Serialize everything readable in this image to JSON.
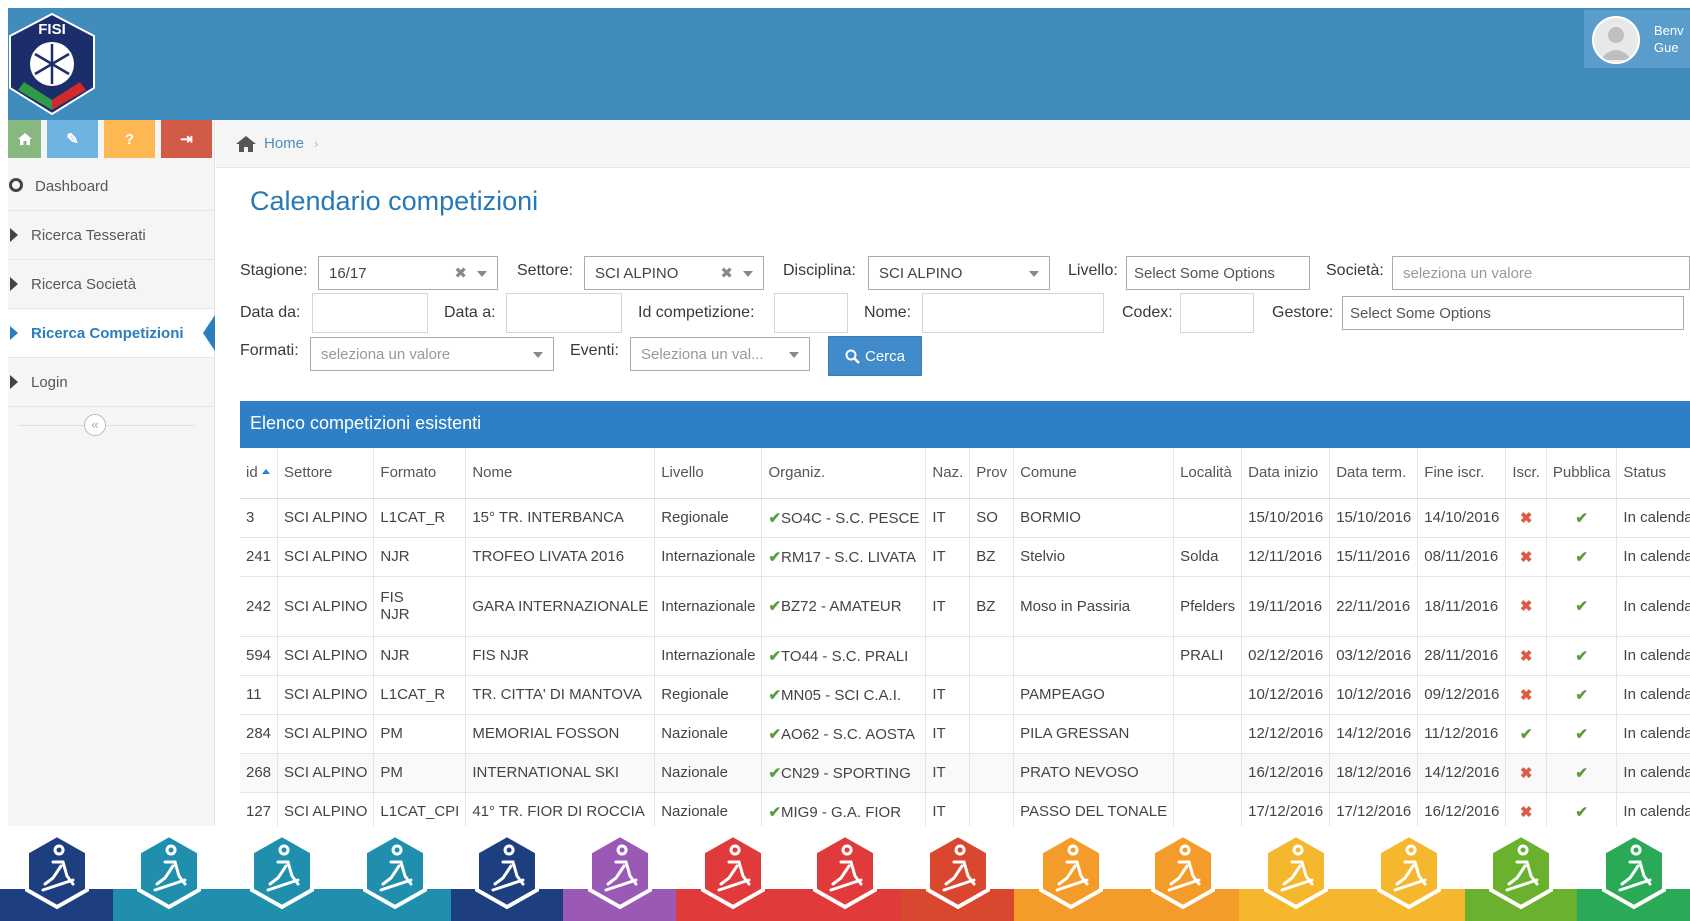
{
  "header": {
    "logo_text": "FISI",
    "user_line1": "Benv",
    "user_line2": "Gue"
  },
  "shortcuts": [
    {
      "icon": "home-icon",
      "color": "#87b87f"
    },
    {
      "icon": "pencil-icon",
      "color": "#6fb3e0",
      "label": "✎"
    },
    {
      "icon": "question-icon",
      "color": "#ffb752",
      "label": "?"
    },
    {
      "icon": "signout-icon",
      "color": "#d15b47",
      "label": "⇥"
    }
  ],
  "sidebar": {
    "items": [
      {
        "label": "Dashboard",
        "icon": "tachometer-icon",
        "active": false
      },
      {
        "label": "Ricerca Tesserati",
        "active": false
      },
      {
        "label": "Ricerca Società",
        "active": false
      },
      {
        "label": "Ricerca Competizioni",
        "active": true
      },
      {
        "label": "Login",
        "active": false
      }
    ],
    "collapse_label": "«"
  },
  "breadcrumb": {
    "home": "Home",
    "sep": "›"
  },
  "page_title": "Calendario competizioni",
  "filters": {
    "stagione_label": "Stagione:",
    "stagione_value": "16/17",
    "settore_label": "Settore:",
    "settore_value": "SCI ALPINO",
    "disciplina_label": "Disciplina:",
    "disciplina_value": "SCI ALPINO",
    "livello_label": "Livello:",
    "livello_value": "Select Some Options",
    "societa_label": "Società:",
    "societa_placeholder": "seleziona un valore",
    "data_da_label": "Data da:",
    "data_a_label": "Data a:",
    "id_label": "Id competizione:",
    "nome_label": "Nome:",
    "codex_label": "Codex:",
    "gestore_label": "Gestore:",
    "gestore_value": "Select Some Options",
    "formati_label": "Formati:",
    "formati_placeholder": "seleziona un valore",
    "eventi_label": "Eventi:",
    "eventi_placeholder": "Seleziona un val...",
    "cerca_label": "Cerca",
    "clear_glyph": "✖"
  },
  "table": {
    "title": "Elenco competizioni esistenti",
    "columns": [
      "id",
      "Settore",
      "Formato",
      "Nome",
      "Livello",
      "Organiz.",
      "Naz.",
      "Prov",
      "Comune",
      "Località",
      "Data inizio",
      "Data term.",
      "Fine iscr.",
      "Iscr.",
      "Pubblica",
      "Status"
    ],
    "rows": [
      {
        "id": "3",
        "settore": "SCI ALPINO",
        "formato": "L1CAT_R",
        "formato2": "",
        "nome": "15° TR. INTERBANCA",
        "livello": "Regionale",
        "organiz": "SO4C - S.C. PESCE",
        "naz": "IT",
        "prov": "SO",
        "comune": "BORMIO",
        "localita": "",
        "inizio": "15/10/2016",
        "term": "15/10/2016",
        "fine": "14/10/2016",
        "iscr": "no",
        "pubblica": "ok",
        "status": "In calendario"
      },
      {
        "id": "241",
        "settore": "SCI ALPINO",
        "formato": "NJR",
        "formato2": "",
        "nome": "TROFEO LIVATA 2016",
        "livello": "Internazionale",
        "organiz": "RM17 - S.C. LIVATA",
        "naz": "IT",
        "prov": "BZ",
        "comune": "Stelvio",
        "localita": "Solda",
        "inizio": "12/11/2016",
        "term": "15/11/2016",
        "fine": "08/11/2016",
        "iscr": "no",
        "pubblica": "ok",
        "status": "In calendario"
      },
      {
        "id": "242",
        "settore": "SCI ALPINO",
        "formato": "FIS",
        "formato2": "NJR",
        "nome": "GARA INTERNAZIONALE",
        "livello": "Internazionale",
        "organiz": "BZ72 - AMATEUR",
        "naz": "IT",
        "prov": "BZ",
        "comune": "Moso in Passiria",
        "localita": "Pfelders",
        "inizio": "19/11/2016",
        "term": "22/11/2016",
        "fine": "18/11/2016",
        "iscr": "no",
        "pubblica": "ok",
        "status": "In calendario"
      },
      {
        "id": "594",
        "settore": "SCI ALPINO",
        "formato": "NJR",
        "formato2": "",
        "nome": "FIS NJR",
        "livello": "Internazionale",
        "organiz": "TO44 - S.C. PRALI",
        "naz": "",
        "prov": "",
        "comune": "",
        "localita": "PRALI",
        "inizio": "02/12/2016",
        "term": "03/12/2016",
        "fine": "28/11/2016",
        "iscr": "no",
        "pubblica": "ok",
        "status": "In calendario"
      },
      {
        "id": "11",
        "settore": "SCI ALPINO",
        "formato": "L1CAT_R",
        "formato2": "",
        "nome": "TR. CITTA' DI MANTOVA",
        "livello": "Regionale",
        "organiz": "MN05 - SCI C.A.I.",
        "naz": "IT",
        "prov": "",
        "comune": "PAMPEAGO",
        "localita": "",
        "inizio": "10/12/2016",
        "term": "10/12/2016",
        "fine": "09/12/2016",
        "iscr": "no",
        "pubblica": "ok",
        "status": "In calendario"
      },
      {
        "id": "284",
        "settore": "SCI ALPINO",
        "formato": "PM",
        "formato2": "",
        "nome": "MEMORIAL FOSSON",
        "livello": "Nazionale",
        "organiz": "AO62 - S.C. AOSTA",
        "naz": "IT",
        "prov": "",
        "comune": "PILA GRESSAN",
        "localita": "",
        "inizio": "12/12/2016",
        "term": "14/12/2016",
        "fine": "11/12/2016",
        "iscr": "ok",
        "pubblica": "ok",
        "status": "In calendario"
      },
      {
        "id": "268",
        "settore": "SCI ALPINO",
        "formato": "PM",
        "formato2": "",
        "nome": "INTERNATIONAL SKI",
        "livello": "Nazionale",
        "organiz": "CN29 - SPORTING",
        "naz": "IT",
        "prov": "",
        "comune": "PRATO NEVOSO",
        "localita": "",
        "inizio": "16/12/2016",
        "term": "18/12/2016",
        "fine": "14/12/2016",
        "iscr": "no",
        "pubblica": "ok",
        "status": "In calendario"
      },
      {
        "id": "127",
        "settore": "SCI ALPINO",
        "formato": "L1CAT_CPI",
        "formato2": "",
        "nome": "41° TR. FIOR DI ROCCIA",
        "livello": "Nazionale",
        "organiz": "MIG9 - G.A. FIOR",
        "naz": "IT",
        "prov": "",
        "comune": "PASSO DEL TONALE",
        "localita": "",
        "inizio": "17/12/2016",
        "term": "17/12/2016",
        "fine": "16/12/2016",
        "iscr": "no",
        "pubblica": "ok",
        "status": "In calendario"
      }
    ],
    "ok_glyph": "✔",
    "no_glyph": "✖"
  },
  "footer": {
    "disciplines": [
      {
        "icon": "snowflake-icon",
        "color": "#1d3f80"
      },
      {
        "icon": "freestyle-icon",
        "color": "#1f8fad"
      },
      {
        "icon": "nordic-combined-icon",
        "color": "#1f8fad"
      },
      {
        "icon": "cross-country-icon",
        "color": "#1f8fad"
      },
      {
        "icon": "alpine-ski-icon",
        "color": "#1d3f80"
      },
      {
        "icon": "telemark-icon",
        "color": "#9b59b6"
      },
      {
        "icon": "snowboard-icon",
        "color": "#e03a3a"
      },
      {
        "icon": "skeleton-icon",
        "color": "#e03a3a"
      },
      {
        "icon": "bob-icon",
        "color": "#d9472f"
      },
      {
        "icon": "luge-icon",
        "color": "#f39c2a"
      },
      {
        "icon": "sled-icon",
        "color": "#f39c2a"
      },
      {
        "icon": "skiroll-icon",
        "color": "#f5b72e"
      },
      {
        "icon": "grass-ski-icon",
        "color": "#f5b72e"
      },
      {
        "icon": "biathlon-icon",
        "color": "#6ab22e"
      },
      {
        "icon": "mountaineering-icon",
        "color": "#2aaa56"
      }
    ]
  }
}
